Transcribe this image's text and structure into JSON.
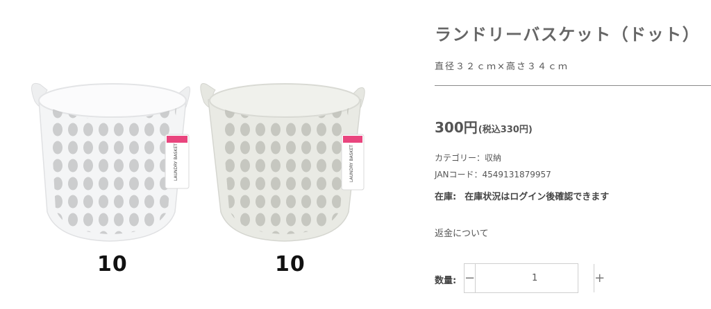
{
  "product": {
    "title": "ランドリーバスケット（ドット）",
    "subtitle": "直径３２ｃｍ×高さ３４ｃｍ",
    "price": "300円",
    "tax_note": "(税込330円)",
    "category": "カテゴリー：収納",
    "jan": "JANコード：4549131879957",
    "stock_label": "在庫:",
    "stock_value": "在庫状況はログイン後確認できます",
    "refund_link": "返金について",
    "quantity_label": "数量:",
    "quantity_value": "1",
    "minus": "−",
    "plus": "+"
  },
  "image": {
    "variants": [
      {
        "number": "10",
        "tag_text": "LAUNDRY BASKET",
        "color": "#f4f5f6"
      },
      {
        "number": "10",
        "tag_text": "LAUNDRY BASKET",
        "color": "#e9eae4"
      }
    ]
  },
  "colors": {
    "tag_pink": "#e9457e"
  }
}
